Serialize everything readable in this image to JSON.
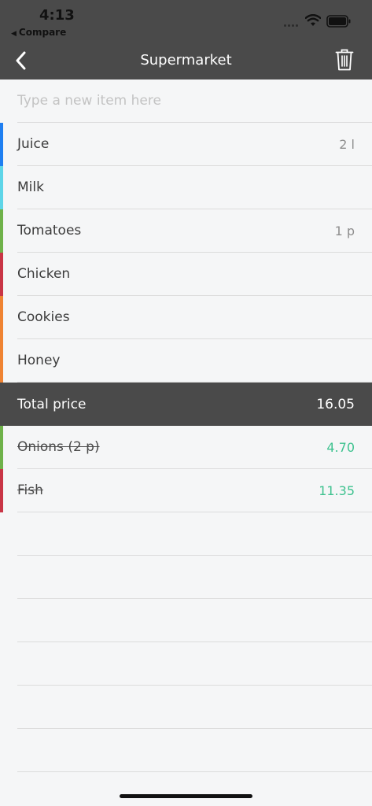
{
  "status_bar": {
    "time": "4:13",
    "back_app": "Compare"
  },
  "nav": {
    "title": "Supermarket"
  },
  "new_item": {
    "placeholder": "Type a new item here"
  },
  "items": [
    {
      "name": "Juice",
      "quantity": "2 l",
      "color": "#1f7ff1"
    },
    {
      "name": "Milk",
      "quantity": "",
      "color": "#5ed5e8"
    },
    {
      "name": "Tomatoes",
      "quantity": "1 p",
      "color": "#6fb24a"
    },
    {
      "name": "Chicken",
      "quantity": "",
      "color": "#c93546"
    },
    {
      "name": "Cookies",
      "quantity": "",
      "color": "#ef8332"
    },
    {
      "name": "Honey",
      "quantity": "",
      "color": "#ef8332"
    }
  ],
  "total": {
    "label": "Total price",
    "value": "16.05"
  },
  "done_items": [
    {
      "name": "Onions (2 p)",
      "price": "4.70",
      "color": "#6fb24a"
    },
    {
      "name": "Fish",
      "price": "11.35",
      "color": "#c93546"
    }
  ],
  "colors": {
    "header_bg": "#4a4a4a",
    "price_green": "#3ec28f",
    "background": "#f5f6f7"
  }
}
